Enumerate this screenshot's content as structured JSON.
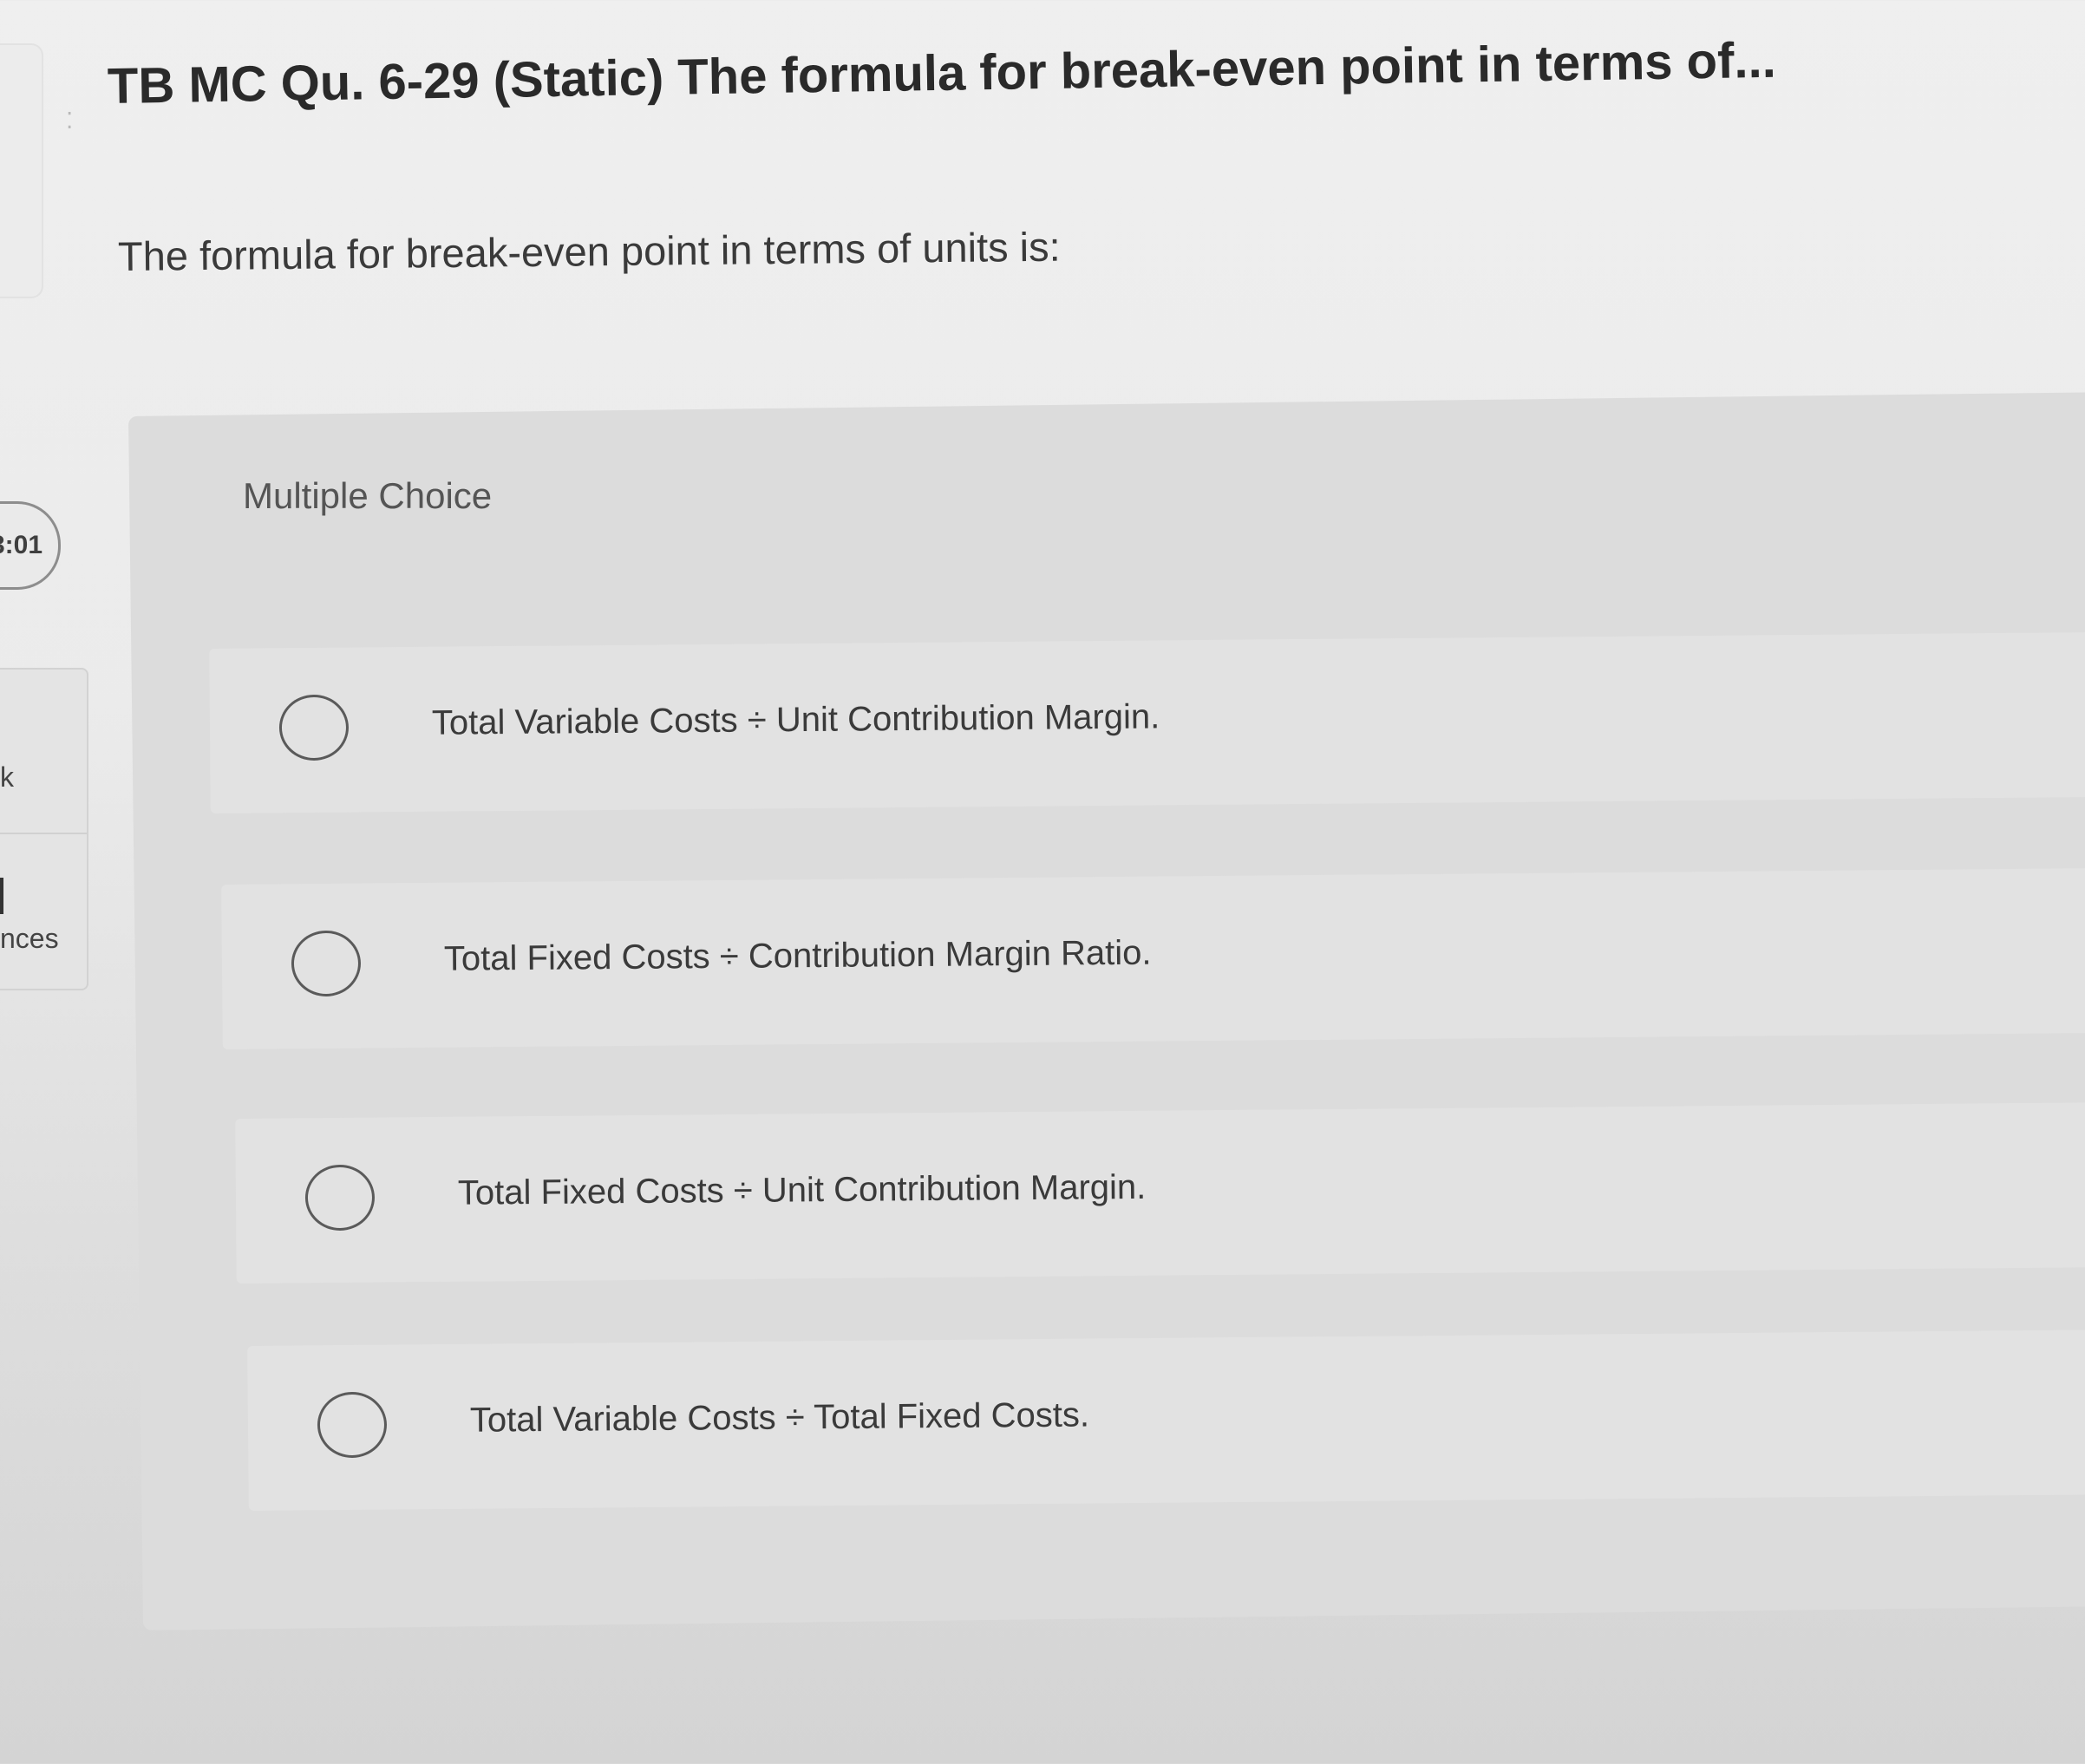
{
  "question": {
    "title": "TB MC Qu. 6-29 (Static) The formula for break-even point in terms of...",
    "prompt": "The formula for break-even point in terms of units is:",
    "type_label": "Multiple Choice"
  },
  "sidebar": {
    "timer": "3:01",
    "item_partial_1": "k",
    "item_partial_2": "nces"
  },
  "options": [
    {
      "label": "Total Variable Costs ÷ Unit Contribution Margin.",
      "selected": false
    },
    {
      "label": "Total Fixed Costs ÷ Contribution Margin Ratio.",
      "selected": false
    },
    {
      "label": "Total Fixed Costs ÷ Unit Contribution Margin.",
      "selected": false
    },
    {
      "label": "Total Variable Costs ÷ Total Fixed Costs.",
      "selected": false
    }
  ]
}
